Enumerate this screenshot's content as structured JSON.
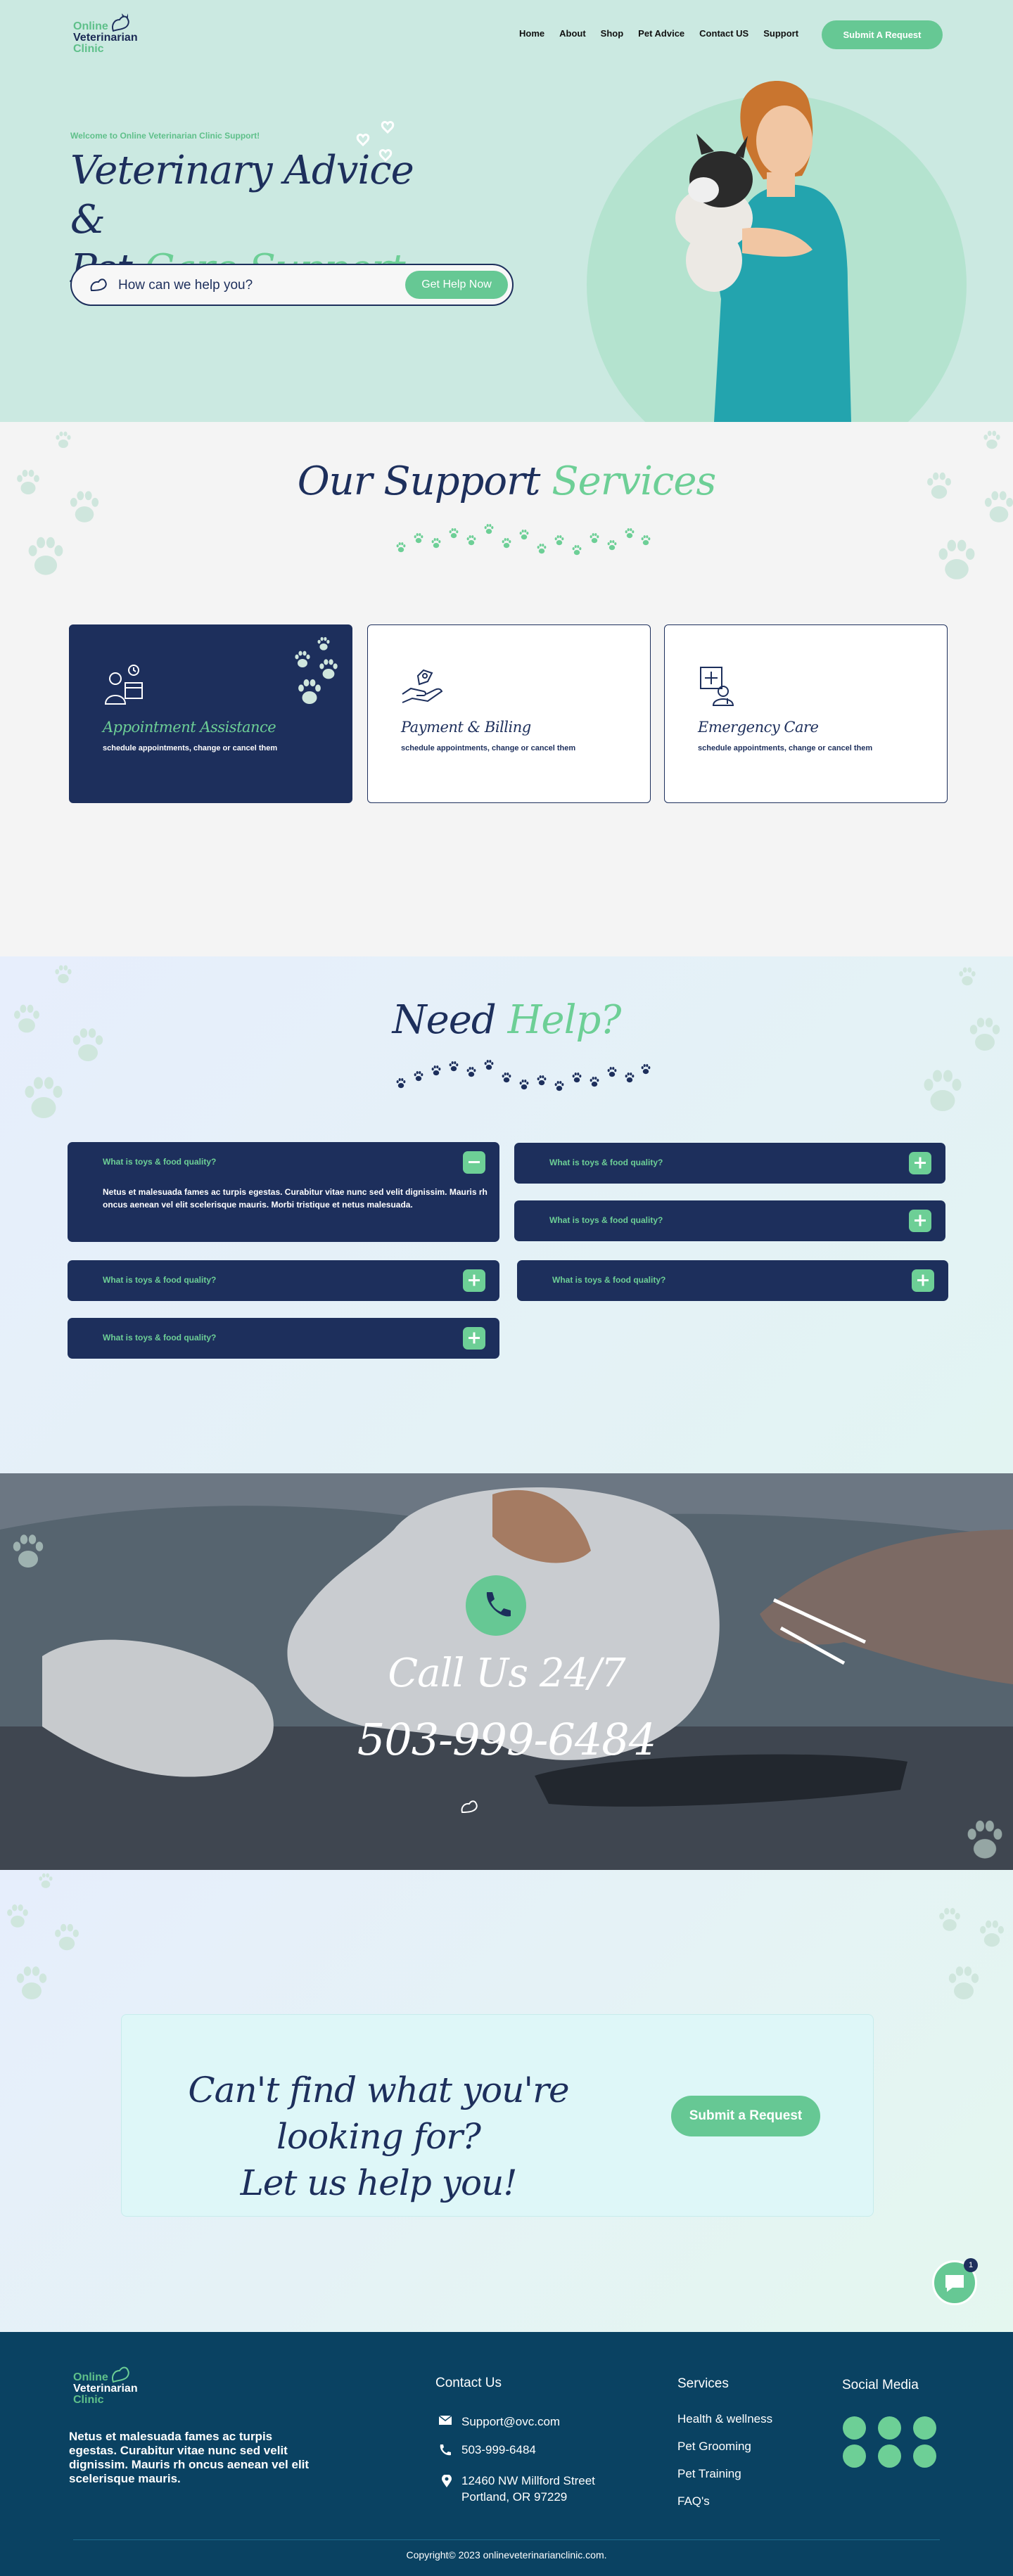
{
  "brand": {
    "line1": "Online",
    "line2": "Veterinarian",
    "line3": "Clinic"
  },
  "nav": {
    "items": [
      "Home",
      "About",
      "Shop",
      "Pet Advice",
      "Contact US",
      "Support"
    ],
    "cta": "Submit A Request"
  },
  "hero": {
    "welcome": "Welcome to Online Veterinarian Clinic Support!",
    "title_line1": "Veterinary Advice &",
    "title_pet": "Pet",
    "title_highlight": "Care Support",
    "search_placeholder": "How can we help you?",
    "search_button": "Get Help Now"
  },
  "services": {
    "title": "Our Support",
    "title_highlight": "Services",
    "cards": [
      {
        "title": "Appointment Assistance",
        "desc": "schedule appointments, change or cancel them",
        "icon": "doctor-calendar-icon"
      },
      {
        "title": "Payment & Billing",
        "desc": "schedule appointments, change or cancel them",
        "icon": "hand-coin-icon"
      },
      {
        "title": "Emergency Care",
        "desc": "schedule appointments, change or cancel them",
        "icon": "medical-kit-icon"
      }
    ]
  },
  "faq": {
    "title": "Need",
    "title_highlight": "Help?",
    "items": [
      {
        "q": "What is toys & food quality?",
        "a": "Netus et malesuada fames ac turpis egestas. Curabitur vitae nunc sed velit dignissim. Mauris rh oncus aenean vel elit scelerisque mauris. Morbi tristique et netus malesuada."
      },
      {
        "q": "What is toys & food quality?"
      },
      {
        "q": "What is toys & food quality?"
      },
      {
        "q": "What is toys & food quality?"
      },
      {
        "q": "What is toys & food quality?"
      },
      {
        "q": "What is toys & food quality?"
      }
    ]
  },
  "call": {
    "label": "Call Us 24/7",
    "number": "503-999-6484"
  },
  "cta": {
    "title_line1": "Can't find what you're looking for?",
    "title_line2": "Let us help you!",
    "button": "Submit a Request",
    "chat_badge": "1"
  },
  "footer": {
    "about": "Netus et malesuada fames ac turpis egestas. Curabitur vitae nunc sed velit dignissim. Mauris rh oncus aenean vel elit scelerisque mauris.",
    "contact_title": "Contact Us",
    "email": "Support@ovc.com",
    "phone": "503-999-6484",
    "address_line1": "12460 NW Millford Street",
    "address_line2": "Portland, OR 97229",
    "services_title": "Services",
    "services": [
      "Health & wellness",
      "Pet Grooming",
      "Pet Training",
      "FAQ's"
    ],
    "social_title": "Social Media",
    "social": [
      "twitter-icon",
      "instagram-icon",
      "facebook-icon",
      "telegram-icon",
      "chat-icon",
      "discord-icon"
    ],
    "copyright": "Copyright© 2023 onlineveterinarianclinic.com."
  },
  "colors": {
    "navy": "#1d2f5c",
    "green": "#66c894",
    "hero_bg": "#cbe9e1",
    "footer_bg": "#0a4262"
  }
}
